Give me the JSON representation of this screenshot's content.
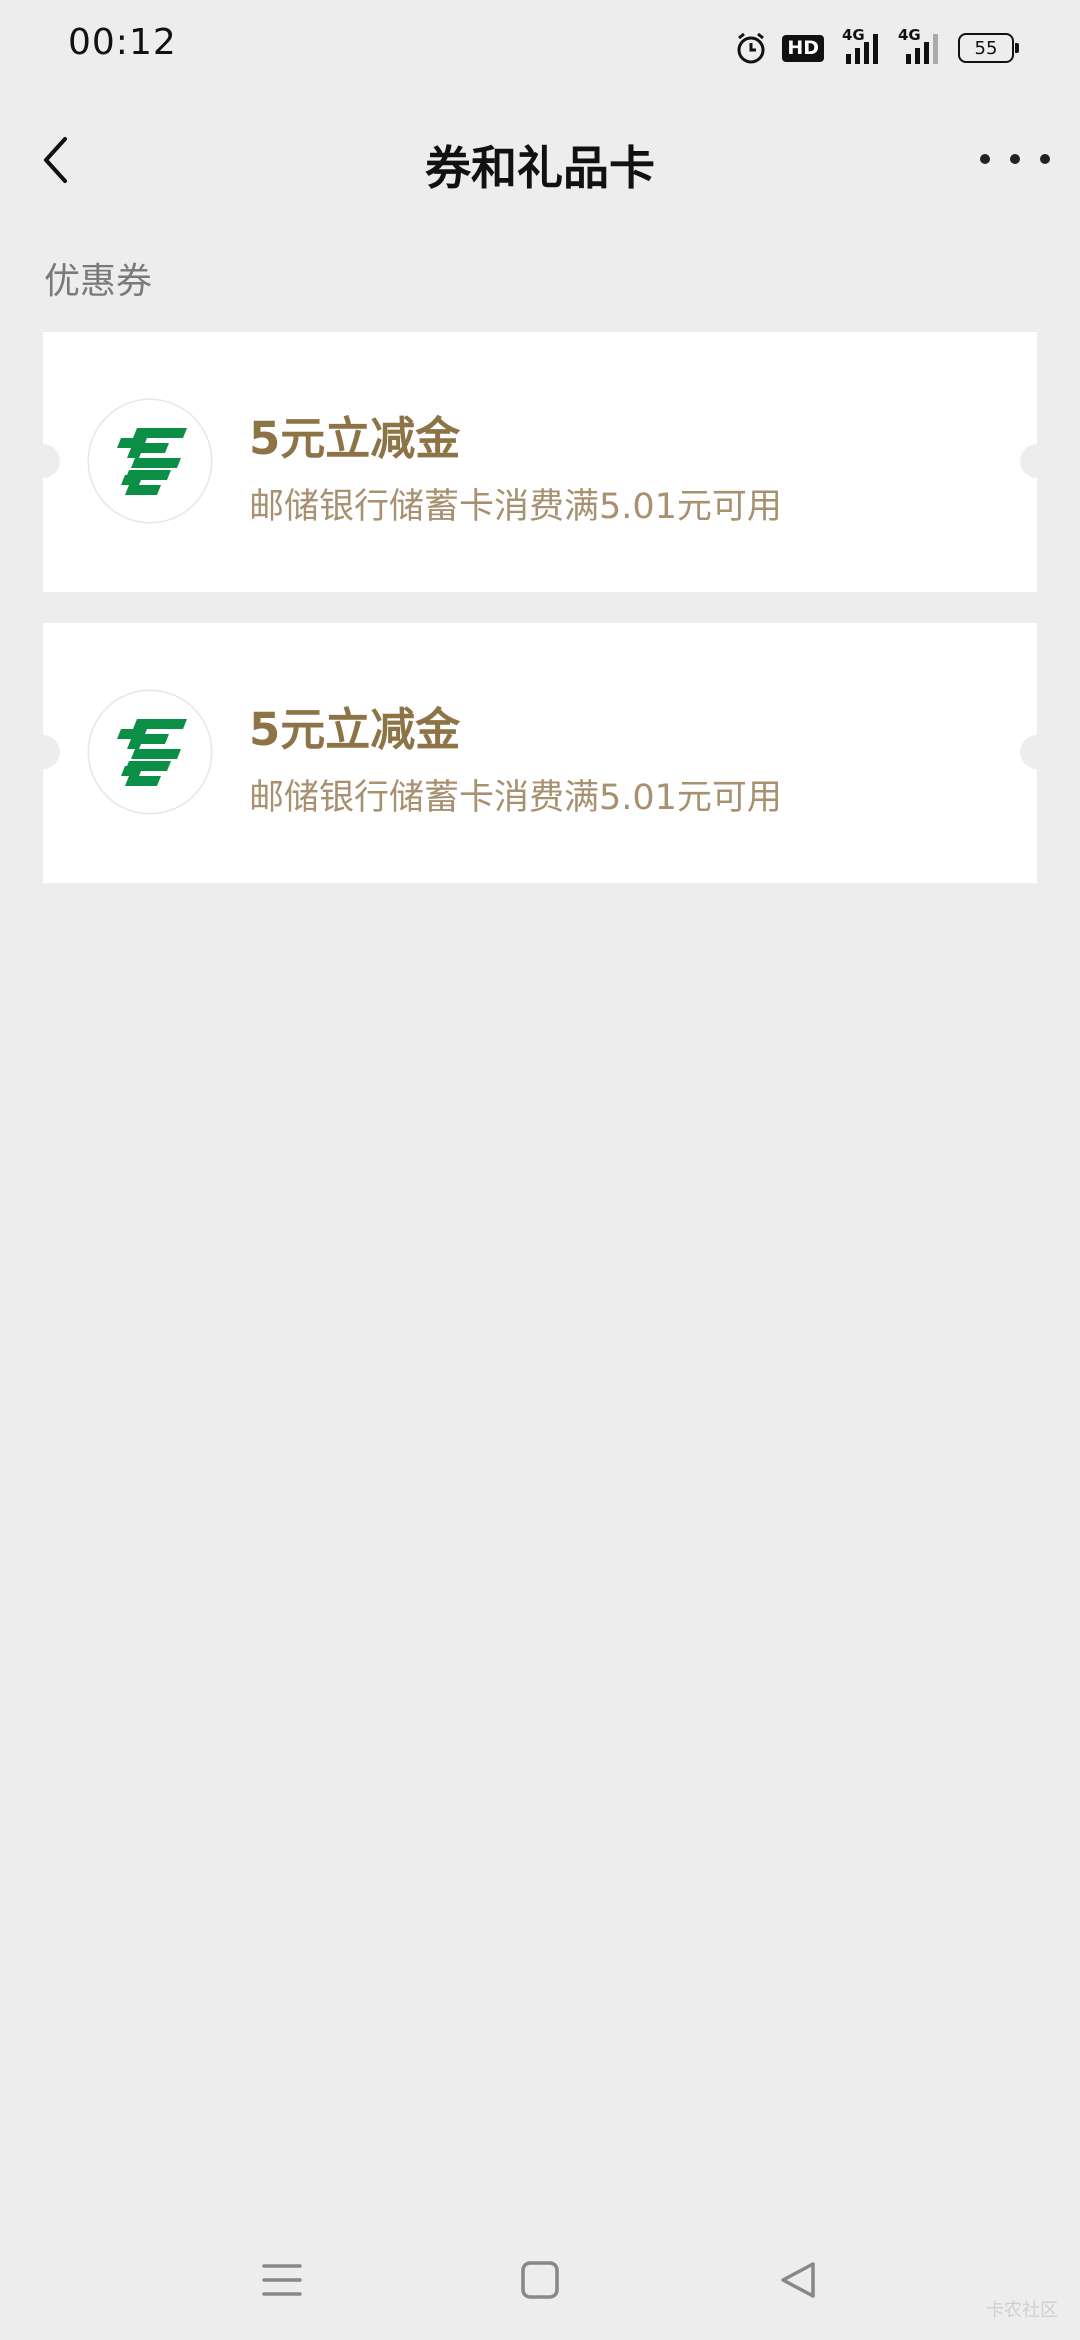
{
  "status_bar": {
    "time": "00:12",
    "hd_label": "HD",
    "network_1": "4G",
    "network_2": "4G",
    "battery": "55"
  },
  "header": {
    "title": "券和礼品卡"
  },
  "section": {
    "title": "优惠券"
  },
  "coupons": [
    {
      "logo_icon": "postal-savings-bank-logo-icon",
      "title": "5元立减金",
      "description": "邮储银行储蓄卡消费满5.01元可用"
    },
    {
      "logo_icon": "postal-savings-bank-logo-icon",
      "title": "5元立减金",
      "description": "邮储银行储蓄卡消费满5.01元可用"
    }
  ],
  "colors": {
    "background": "#ededed",
    "coupon_title": "#8c7447",
    "coupon_desc": "#a89170",
    "logo_green": "#0b8f47"
  },
  "icons": {
    "back": "chevron-left-icon",
    "more": "more-dots-icon",
    "alarm": "alarm-icon",
    "nav_menu": "menu-icon",
    "nav_home": "home-square-icon",
    "nav_back": "back-triangle-icon"
  },
  "watermark": "卡农社区"
}
